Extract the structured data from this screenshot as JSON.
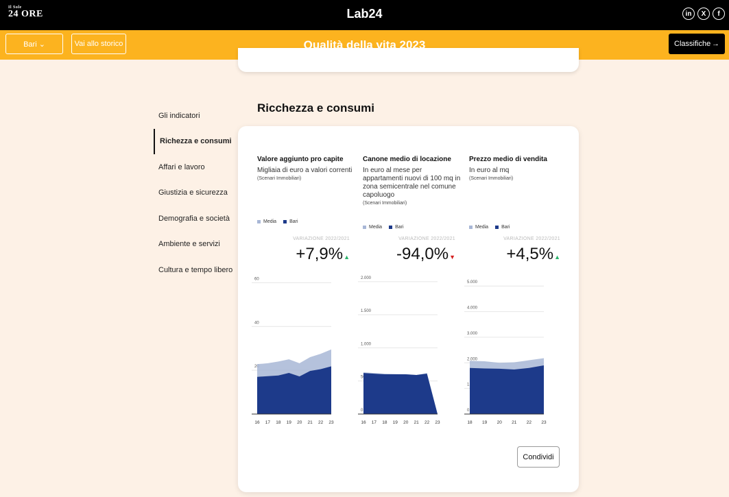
{
  "topbar": {
    "logo_left_top": "Il Sole",
    "logo_left": "24 ORE",
    "logo_center": "Lab24",
    "socials": [
      "in",
      "X",
      "f"
    ]
  },
  "subbar": {
    "city_button": "Bari ⌄",
    "history_button": "Vai allo storico",
    "title": "Qualità della vita 2023",
    "rankings_button": "Classifiche",
    "rankings_arrow": "→"
  },
  "nav": {
    "items": [
      {
        "label": "Gli indicatori",
        "active": false
      },
      {
        "label": "Richezza e consumi",
        "active": true
      },
      {
        "label": "Affari e lavoro",
        "active": false
      },
      {
        "label": "Giustizia e sicurezza",
        "active": false
      },
      {
        "label": "Demografia e società",
        "active": false
      },
      {
        "label": "Ambiente e servizi",
        "active": false
      },
      {
        "label": "Cultura e tempo libero",
        "active": false
      }
    ]
  },
  "section": {
    "title": "Ricchezza e consumi"
  },
  "legend": {
    "media": "Media",
    "bari": "Bari"
  },
  "colors": {
    "accent": "#fcb31f",
    "media": "#a8b7d6",
    "bari": "#1d3a8a",
    "up": "#2bb36b",
    "down": "#d42020"
  },
  "indicators": [
    {
      "title": "Valore aggiunto pro capite",
      "subtitle": "Migliaia di euro a valori correnti",
      "source": "(Scenari Immobiliari)",
      "variation_label": "VARIAZIONE 2022/2021",
      "variation_sign": "+",
      "variation_value": "7,9%",
      "trend": "up"
    },
    {
      "title": "Canone medio di locazione",
      "subtitle": "In euro al mese per appartamenti nuovi di 100 mq in zona semicentrale nel comune capoluogo",
      "source": "(Scenari Immobiliari)",
      "variation_label": "VARIAZIONE 2022/2021",
      "variation_sign": "-",
      "variation_value": "94,0%",
      "trend": "down"
    },
    {
      "title": "Prezzo medio di vendita",
      "subtitle": "In euro al mq",
      "source": "(Scenari Immobiliari)",
      "variation_label": "VARIAZIONE 2022/2021",
      "variation_sign": "+",
      "variation_value": "4,5%",
      "trend": "up"
    }
  ],
  "chart_data": [
    {
      "type": "area",
      "x": [
        "16",
        "17",
        "18",
        "19",
        "20",
        "21",
        "22",
        "23"
      ],
      "ylim": [
        0,
        62
      ],
      "yticks": [
        20,
        40,
        60
      ],
      "ytick_labels": [
        "20",
        "40",
        "60"
      ],
      "series": [
        {
          "name": "Media",
          "values": [
            22.8,
            23.2,
            24.0,
            25.0,
            23.2,
            26.0,
            27.5,
            29.5
          ]
        },
        {
          "name": "Bari",
          "values": [
            17.0,
            17.3,
            17.6,
            18.8,
            17.2,
            19.7,
            20.5,
            21.8
          ]
        }
      ]
    },
    {
      "type": "area",
      "x": [
        "16",
        "17",
        "18",
        "19",
        "20",
        "21",
        "22",
        "23"
      ],
      "ylim": [
        0,
        2050
      ],
      "yticks": [
        0,
        500,
        1000,
        1500,
        2000
      ],
      "ytick_labels": [
        "0",
        "500",
        "1.000",
        "1.500",
        "2.000"
      ],
      "series": [
        {
          "name": "Media",
          "values": [
            630,
            620,
            610,
            605,
            600,
            590,
            620,
            0
          ]
        },
        {
          "name": "Bari",
          "values": [
            620,
            610,
            600,
            600,
            600,
            590,
            610,
            0
          ]
        }
      ]
    },
    {
      "type": "area",
      "x": [
        "18",
        "19",
        "20",
        "21",
        "22",
        "23"
      ],
      "ylim": [
        0,
        5300
      ],
      "yticks": [
        0,
        1000,
        2000,
        3000,
        4000,
        5000
      ],
      "ytick_labels": [
        "0",
        "1.000",
        "2.000",
        "3.000",
        "4.000",
        "5.000"
      ],
      "series": [
        {
          "name": "Media",
          "values": [
            2080,
            2060,
            2000,
            2020,
            2100,
            2180
          ]
        },
        {
          "name": "Bari",
          "values": [
            1800,
            1780,
            1770,
            1740,
            1800,
            1900
          ]
        }
      ]
    }
  ],
  "share_button": "Condividi"
}
